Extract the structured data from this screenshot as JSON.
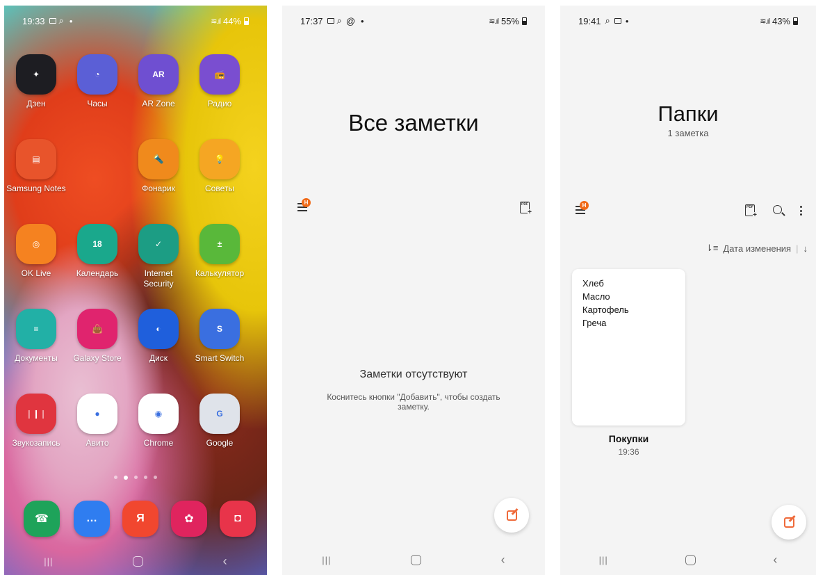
{
  "phone1": {
    "status": {
      "time": "19:33",
      "battery": "44%"
    },
    "apps": [
      {
        "label": "Дзен",
        "glyph": "✦",
        "color": "#1d1d22",
        "icon": "zen-icon"
      },
      {
        "label": "Часы",
        "glyph": "◔",
        "color": "#5b5fd6",
        "icon": "clock-icon"
      },
      {
        "label": "AR Zone",
        "glyph": "AR",
        "color": "#6f4fd1",
        "icon": "ar-zone-icon"
      },
      {
        "label": "Радио",
        "glyph": "📻",
        "color": "#7a4ed0",
        "icon": "radio-icon"
      },
      {
        "label": "Samsung Notes",
        "glyph": "▤",
        "color": "#e8542b",
        "icon": "samsung-notes-icon"
      },
      {
        "label": "Фонарик",
        "glyph": "🔦",
        "color": "#f08a1c",
        "icon": "flashlight-icon"
      },
      {
        "label": "Советы",
        "glyph": "💡",
        "color": "#f5a623",
        "icon": "tips-icon"
      },
      {
        "label": "OK Live",
        "glyph": "◎",
        "color": "#f58220",
        "icon": "ok-live-icon"
      },
      {
        "label": "Календарь",
        "glyph": "18",
        "color": "#1aa88c",
        "icon": "calendar-icon"
      },
      {
        "label": "Internet Security",
        "glyph": "✓",
        "color": "#1c9d84",
        "icon": "shield-icon"
      },
      {
        "label": "Калькулятор",
        "glyph": "±",
        "color": "#59b83a",
        "icon": "calculator-icon"
      },
      {
        "label": "Документы",
        "glyph": "≡",
        "color": "#22b0a6",
        "icon": "documents-icon"
      },
      {
        "label": "Galaxy Store",
        "glyph": "👜",
        "color": "#e0246e",
        "icon": "galaxy-store-icon"
      },
      {
        "label": "Диск",
        "glyph": "◐",
        "color": "#1f5fdc",
        "icon": "disk-icon"
      },
      {
        "label": "Smart Switch",
        "glyph": "S",
        "color": "#3a6fe0",
        "icon": "smart-switch-icon"
      },
      {
        "label": "Звукозапись",
        "glyph": "❘❙❘",
        "color": "#e0353f",
        "icon": "voice-recorder-icon"
      },
      {
        "label": "Авито",
        "glyph": "●",
        "color": "#ffffff",
        "icon": "avito-icon"
      },
      {
        "label": "Chrome",
        "glyph": "◉",
        "color": "#ffffff",
        "icon": "chrome-icon"
      },
      {
        "label": "Google",
        "glyph": "G",
        "color": "#dfe3ea",
        "icon": "google-folder-icon"
      }
    ],
    "dock": [
      {
        "glyph": "☎",
        "color": "#1ea35a",
        "icon": "phone-icon"
      },
      {
        "glyph": "…",
        "color": "#2f7df0",
        "icon": "messages-icon"
      },
      {
        "glyph": "Я",
        "color": "#f1472f",
        "icon": "yandex-icon"
      },
      {
        "glyph": "✿",
        "color": "#e0245e",
        "icon": "gallery-icon"
      },
      {
        "glyph": "◘",
        "color": "#e8344a",
        "icon": "camera-icon"
      }
    ]
  },
  "phone2": {
    "status": {
      "time": "17:37",
      "battery": "55%"
    },
    "title": "Все заметки",
    "badge": "H",
    "empty_title": "Заметки отсутствуют",
    "empty_sub": "Коснитесь кнопки \"Добавить\", чтобы создать заметку."
  },
  "phone3": {
    "status": {
      "time": "19:41",
      "battery": "43%"
    },
    "title": "Папки",
    "subtitle": "1 заметка",
    "badge": "H",
    "sort_label": "Дата изменения",
    "note": {
      "lines": [
        "Хлеб",
        "Масло",
        "Картофель",
        "Греча"
      ],
      "title": "Покупки",
      "time": "19:36"
    }
  }
}
